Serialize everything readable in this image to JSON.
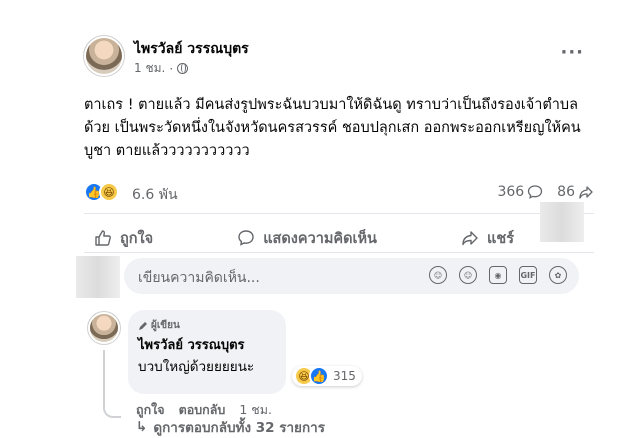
{
  "post": {
    "author": "ไพรวัลย์ วรรณบุตร",
    "time": "1 ชม.",
    "text": "ตาเถร ! ตายแล้ว มีคนส่งรูปพระฉันบวบมาให้ดิฉันดู ทราบว่าเป็นถึงรองเจ้าตำบลด้วย เป็นพระวัดหนึ่งในจังหวัดนครสวรรค์ ชอบปลุกเสก ออกพระออกเหรียญให้คนบูชา ตายแล้ววววววววววว",
    "reaction_count": "6.6 พัน",
    "comment_count": "366",
    "share_count": "86"
  },
  "actions": {
    "like_label": "ถูกใจ",
    "comment_label": "แสดงความคิดเห็น",
    "share_label": "แชร์"
  },
  "comment_input": {
    "placeholder": "เขียนความคิดเห็น..."
  },
  "comment": {
    "badge": "ผู้เขียน",
    "author": "ไพรวัลย์ วรรณบุตร",
    "text": "บวบใหญ่ด้วยยยยนะ",
    "reaction_count": "315",
    "like_label": "ถูกใจ",
    "reply_label": "ตอบกลับ",
    "time": "1 ชม.",
    "view_replies": "ดูการตอบกลับทั้ง 32 รายการ"
  },
  "colors": {
    "like_blue": "#1877f2",
    "muted_text": "#65676b",
    "input_bg": "#f0f2f5"
  }
}
